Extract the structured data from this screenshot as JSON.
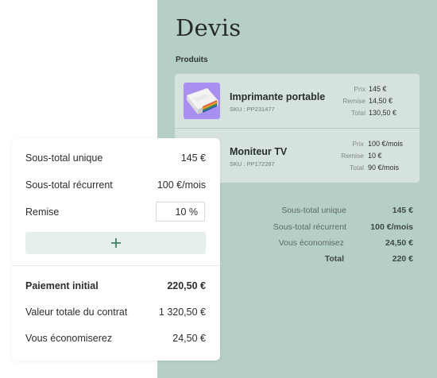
{
  "quote": {
    "title": "Devis",
    "products_label": "Produits",
    "products": [
      {
        "name": "Imprimante portable",
        "sku": "SKU : PP231477",
        "price_label": "Prix",
        "price": "145 €",
        "discount_label": "Remise",
        "discount": "14,50 €",
        "total_label": "Total",
        "total": "130,50 €",
        "thumbnail_icon": "printer-thumbnail"
      },
      {
        "name": "Moniteur TV",
        "sku": "SKU : PP172287",
        "price_label": "Prix",
        "price": "100 €/mois",
        "discount_label": "Remise",
        "discount": "10 €",
        "total_label": "Total",
        "total": "90 €/mois"
      }
    ],
    "totals": [
      {
        "label": "Sous-total unique",
        "value": "145 €"
      },
      {
        "label": "Sous-total récurrent",
        "value": "100 €/mois"
      },
      {
        "label": "Vous économisez",
        "value": "24,50 €"
      },
      {
        "label": "Total",
        "value": "220 €"
      }
    ]
  },
  "summary_card": {
    "one_time_subtotal_label": "Sous-total unique",
    "one_time_subtotal_value": "145 €",
    "recurring_subtotal_label": "Sous-total récurrent",
    "recurring_subtotal_value": "100 €/mois",
    "discount_label": "Remise",
    "discount_value": "10 %",
    "add_button_icon": "plus-icon",
    "initial_payment_label": "Paiement initial",
    "initial_payment_value": "220,50 €",
    "contract_value_label": "Valeur totale du contrat",
    "contract_value_value": "1 320,50 €",
    "savings_label": "Vous économiserez",
    "savings_value": "24,50 €"
  },
  "colors": {
    "panel_background": "#b6cfc5",
    "product_card_background": "#d6e2dd",
    "thumbnail_background": "#a98ff0",
    "add_button_background": "#e6efec",
    "accent_green": "#2f7a5a"
  }
}
